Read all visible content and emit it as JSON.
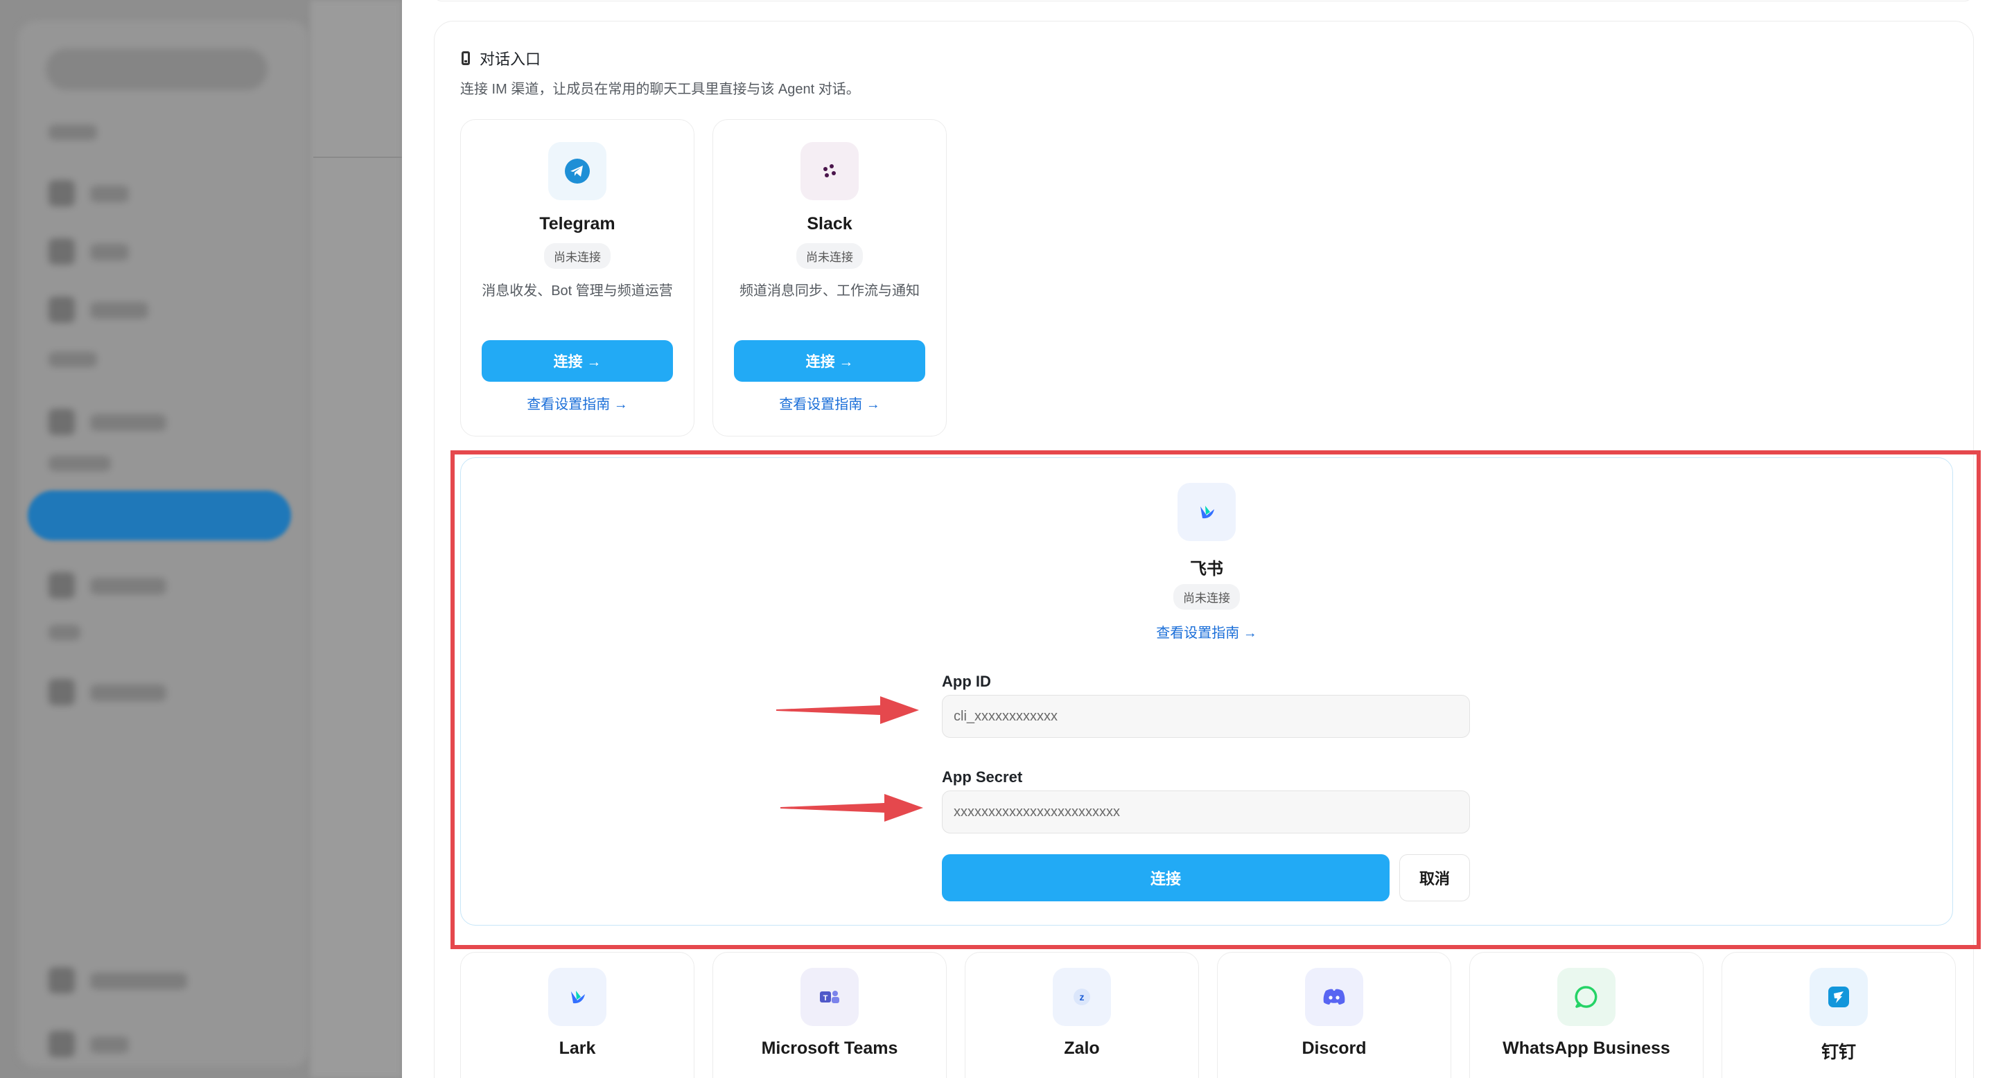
{
  "section": {
    "title": "对话入口",
    "description": "连接 IM 渠道，让成员在常用的聊天工具里直接与该 Agent 对话。"
  },
  "channels_top": [
    {
      "name": "Telegram",
      "status": "尚未连接",
      "description": "消息收发、Bot 管理与频道运营",
      "connect_label": "连接 →",
      "guide_label": "查看设置指南 →",
      "icon": "telegram-icon"
    },
    {
      "name": "Slack",
      "status": "尚未连接",
      "description": "频道消息同步、工作流与通知",
      "connect_label": "连接 →",
      "guide_label": "查看设置指南 →",
      "icon": "slack-icon"
    }
  ],
  "feishu": {
    "name": "飞书",
    "status": "尚未连接",
    "guide_label": "查看设置指南 →",
    "app_id_label": "App ID",
    "app_id_placeholder": "cli_xxxxxxxxxxxx",
    "app_secret_label": "App Secret",
    "app_secret_placeholder": "xxxxxxxxxxxxxxxxxxxxxxxx",
    "connect_label": "连接",
    "cancel_label": "取消",
    "icon": "feishu-icon"
  },
  "channels_bottom": [
    {
      "name": "Lark",
      "icon": "lark-icon"
    },
    {
      "name": "Microsoft Teams",
      "icon": "teams-icon"
    },
    {
      "name": "Zalo",
      "icon": "zalo-icon"
    },
    {
      "name": "Discord",
      "icon": "discord-icon"
    },
    {
      "name": "WhatsApp Business",
      "icon": "whatsapp-icon"
    },
    {
      "name": "钉钉",
      "icon": "dingtalk-icon"
    }
  ],
  "colors": {
    "primary_button": "#22aaf5",
    "link": "#1a6ed8",
    "highlight_annotation": "#e5484d",
    "sidebar_active": "#1f78b9"
  }
}
